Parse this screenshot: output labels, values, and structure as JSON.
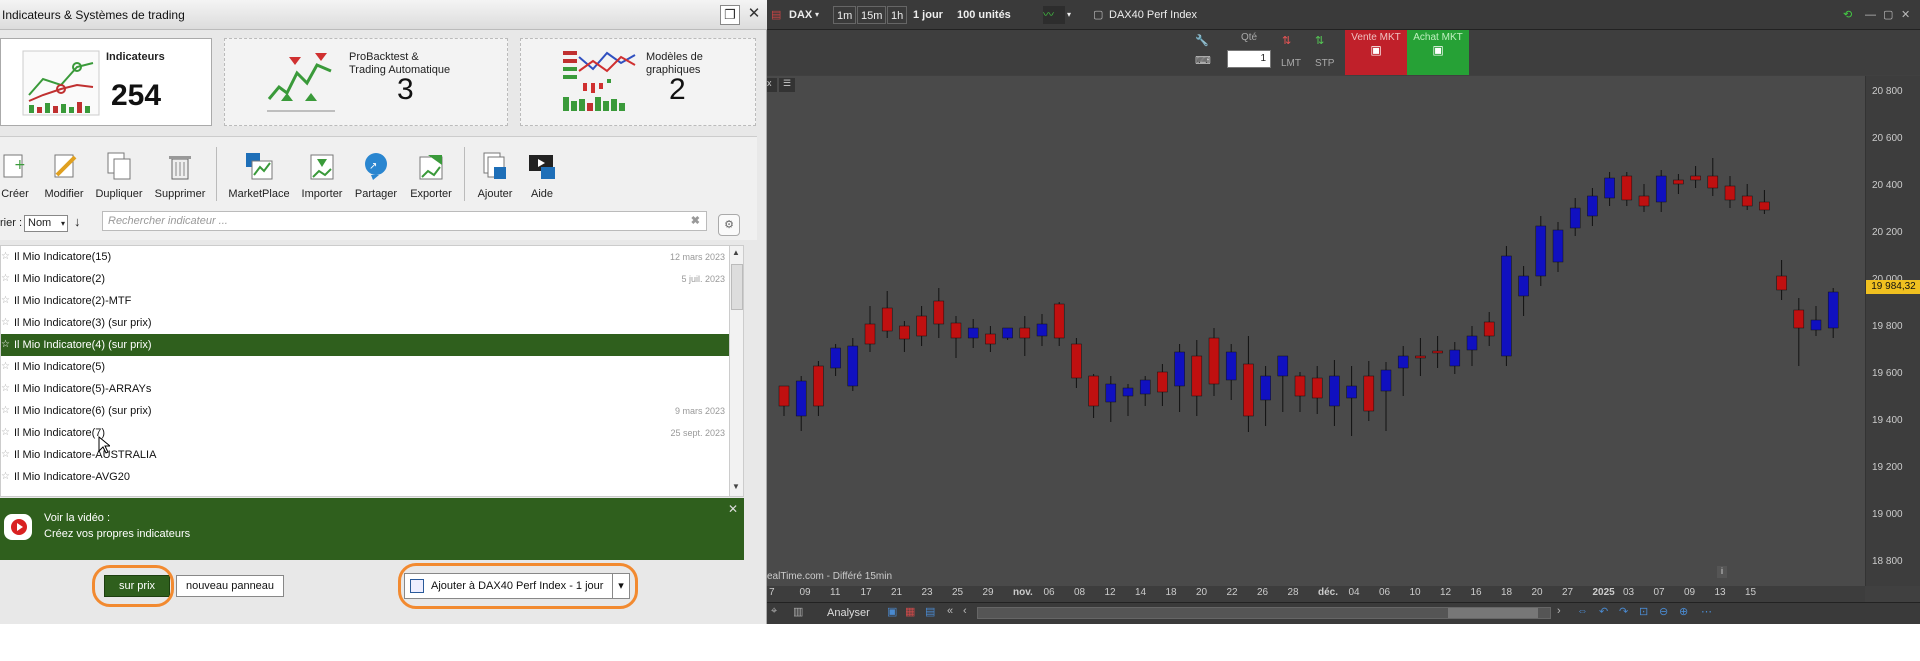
{
  "dialog": {
    "title": "Indicateurs & Systèmes de trading",
    "cards": [
      {
        "label": "Indicateurs",
        "count": "254"
      },
      {
        "label_line1": "ProBacktest &",
        "label_line2": "Trading Automatique",
        "count": "3"
      },
      {
        "label_line1": "Modèles de",
        "label_line2": "graphiques",
        "count": "2"
      }
    ],
    "tools": [
      "Créer",
      "Modifier",
      "Dupliquer",
      "Supprimer",
      "MarketPlace",
      "Importer",
      "Partager",
      "Exporter",
      "Ajouter",
      "Aide"
    ],
    "sort_label": "rier :",
    "sort_value": "Nom",
    "search_placeholder": "Rechercher indicateur ...",
    "rows": [
      {
        "name": "Il Mio Indicatore(15)",
        "date": "12 mars 2023"
      },
      {
        "name": "Il Mio Indicatore(2)",
        "date": "5 juil. 2023"
      },
      {
        "name": "Il Mio Indicatore(2)-MTF",
        "date": ""
      },
      {
        "name": "Il Mio Indicatore(3) (sur prix)",
        "date": ""
      },
      {
        "name": "Il Mio Indicatore(4) (sur prix)",
        "date": ""
      },
      {
        "name": "Il Mio Indicatore(5)",
        "date": ""
      },
      {
        "name": "Il Mio Indicatore(5)-ARRAYs",
        "date": ""
      },
      {
        "name": "Il Mio Indicatore(6) (sur prix)",
        "date": "9 mars 2023"
      },
      {
        "name": "Il Mio Indicatore(7)",
        "date": "25 sept. 2023"
      },
      {
        "name": "Il Mio Indicatore-AUSTRALIA",
        "date": ""
      },
      {
        "name": "Il Mio Indicatore-AVG20",
        "date": ""
      }
    ],
    "selected_row": 4,
    "video_line1": "Voir la vidéo :",
    "video_line2": "Créez vos propres indicateurs",
    "btn_sur_prix": "sur prix",
    "btn_nouveau": "nouveau panneau",
    "btn_ajouter": "Ajouter à DAX40 Perf Index - 1 jour"
  },
  "chart": {
    "instrument": "DAX",
    "timeframes": [
      "1m",
      "15m",
      "1h"
    ],
    "period": "1 jour",
    "units": "100 unités",
    "title": "DAX40 Perf Index",
    "qty_label": "Qté",
    "qty_value": "1",
    "lmt": "LMT",
    "stp": "STP",
    "sell": "Vente MKT",
    "buy": "Achat MKT",
    "current_price": "19 984,32",
    "source": "ealTime.com - Différé 15min",
    "analyser": "Analyser",
    "price_ticks": [
      "20 800",
      "20 600",
      "20 400",
      "20 200",
      "20 000",
      "19 800",
      "19 600",
      "19 400",
      "19 200",
      "19 000",
      "18 800"
    ],
    "date_ticks": [
      "7",
      "09",
      "11",
      "17",
      "21",
      "23",
      "25",
      "29",
      "nov.",
      "06",
      "08",
      "12",
      "14",
      "18",
      "20",
      "22",
      "26",
      "28",
      "déc.",
      "04",
      "06",
      "10",
      "12",
      "16",
      "18",
      "20",
      "27",
      "2025",
      "03",
      "07",
      "09",
      "13",
      "15"
    ]
  },
  "colors": {
    "up": "#1010c0",
    "down": "#c01010",
    "accent_green": "#2f5f1d",
    "highlight": "#f28a30"
  }
}
